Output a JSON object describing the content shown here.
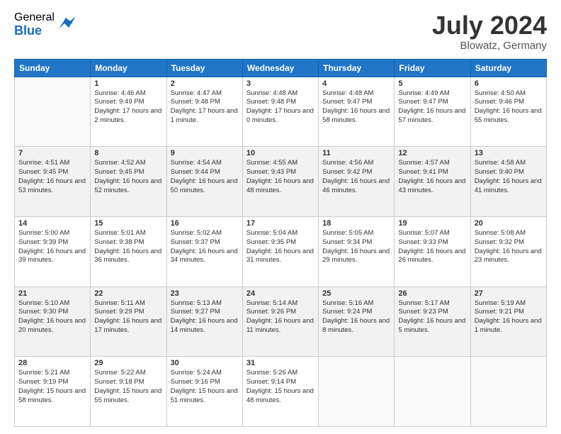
{
  "header": {
    "logo_general": "General",
    "logo_blue": "Blue",
    "month_year": "July 2024",
    "location": "Blowatz, Germany"
  },
  "days_of_week": [
    "Sunday",
    "Monday",
    "Tuesday",
    "Wednesday",
    "Thursday",
    "Friday",
    "Saturday"
  ],
  "weeks": [
    [
      {
        "day": "",
        "sunrise": "",
        "sunset": "",
        "daylight": ""
      },
      {
        "day": "1",
        "sunrise": "Sunrise: 4:46 AM",
        "sunset": "Sunset: 9:49 PM",
        "daylight": "Daylight: 17 hours and 2 minutes."
      },
      {
        "day": "2",
        "sunrise": "Sunrise: 4:47 AM",
        "sunset": "Sunset: 9:48 PM",
        "daylight": "Daylight: 17 hours and 1 minute."
      },
      {
        "day": "3",
        "sunrise": "Sunrise: 4:48 AM",
        "sunset": "Sunset: 9:48 PM",
        "daylight": "Daylight: 17 hours and 0 minutes."
      },
      {
        "day": "4",
        "sunrise": "Sunrise: 4:48 AM",
        "sunset": "Sunset: 9:47 PM",
        "daylight": "Daylight: 16 hours and 58 minutes."
      },
      {
        "day": "5",
        "sunrise": "Sunrise: 4:49 AM",
        "sunset": "Sunset: 9:47 PM",
        "daylight": "Daylight: 16 hours and 57 minutes."
      },
      {
        "day": "6",
        "sunrise": "Sunrise: 4:50 AM",
        "sunset": "Sunset: 9:46 PM",
        "daylight": "Daylight: 16 hours and 55 minutes."
      }
    ],
    [
      {
        "day": "7",
        "sunrise": "Sunrise: 4:51 AM",
        "sunset": "Sunset: 9:45 PM",
        "daylight": "Daylight: 16 hours and 53 minutes."
      },
      {
        "day": "8",
        "sunrise": "Sunrise: 4:52 AM",
        "sunset": "Sunset: 9:45 PM",
        "daylight": "Daylight: 16 hours and 52 minutes."
      },
      {
        "day": "9",
        "sunrise": "Sunrise: 4:54 AM",
        "sunset": "Sunset: 9:44 PM",
        "daylight": "Daylight: 16 hours and 50 minutes."
      },
      {
        "day": "10",
        "sunrise": "Sunrise: 4:55 AM",
        "sunset": "Sunset: 9:43 PM",
        "daylight": "Daylight: 16 hours and 48 minutes."
      },
      {
        "day": "11",
        "sunrise": "Sunrise: 4:56 AM",
        "sunset": "Sunset: 9:42 PM",
        "daylight": "Daylight: 16 hours and 46 minutes."
      },
      {
        "day": "12",
        "sunrise": "Sunrise: 4:57 AM",
        "sunset": "Sunset: 9:41 PM",
        "daylight": "Daylight: 16 hours and 43 minutes."
      },
      {
        "day": "13",
        "sunrise": "Sunrise: 4:58 AM",
        "sunset": "Sunset: 9:40 PM",
        "daylight": "Daylight: 16 hours and 41 minutes."
      }
    ],
    [
      {
        "day": "14",
        "sunrise": "Sunrise: 5:00 AM",
        "sunset": "Sunset: 9:39 PM",
        "daylight": "Daylight: 16 hours and 39 minutes."
      },
      {
        "day": "15",
        "sunrise": "Sunrise: 5:01 AM",
        "sunset": "Sunset: 9:38 PM",
        "daylight": "Daylight: 16 hours and 36 minutes."
      },
      {
        "day": "16",
        "sunrise": "Sunrise: 5:02 AM",
        "sunset": "Sunset: 9:37 PM",
        "daylight": "Daylight: 16 hours and 34 minutes."
      },
      {
        "day": "17",
        "sunrise": "Sunrise: 5:04 AM",
        "sunset": "Sunset: 9:35 PM",
        "daylight": "Daylight: 16 hours and 31 minutes."
      },
      {
        "day": "18",
        "sunrise": "Sunrise: 5:05 AM",
        "sunset": "Sunset: 9:34 PM",
        "daylight": "Daylight: 16 hours and 29 minutes."
      },
      {
        "day": "19",
        "sunrise": "Sunrise: 5:07 AM",
        "sunset": "Sunset: 9:33 PM",
        "daylight": "Daylight: 16 hours and 26 minutes."
      },
      {
        "day": "20",
        "sunrise": "Sunrise: 5:08 AM",
        "sunset": "Sunset: 9:32 PM",
        "daylight": "Daylight: 16 hours and 23 minutes."
      }
    ],
    [
      {
        "day": "21",
        "sunrise": "Sunrise: 5:10 AM",
        "sunset": "Sunset: 9:30 PM",
        "daylight": "Daylight: 16 hours and 20 minutes."
      },
      {
        "day": "22",
        "sunrise": "Sunrise: 5:11 AM",
        "sunset": "Sunset: 9:29 PM",
        "daylight": "Daylight: 16 hours and 17 minutes."
      },
      {
        "day": "23",
        "sunrise": "Sunrise: 5:13 AM",
        "sunset": "Sunset: 9:27 PM",
        "daylight": "Daylight: 16 hours and 14 minutes."
      },
      {
        "day": "24",
        "sunrise": "Sunrise: 5:14 AM",
        "sunset": "Sunset: 9:26 PM",
        "daylight": "Daylight: 16 hours and 11 minutes."
      },
      {
        "day": "25",
        "sunrise": "Sunrise: 5:16 AM",
        "sunset": "Sunset: 9:24 PM",
        "daylight": "Daylight: 16 hours and 8 minutes."
      },
      {
        "day": "26",
        "sunrise": "Sunrise: 5:17 AM",
        "sunset": "Sunset: 9:23 PM",
        "daylight": "Daylight: 16 hours and 5 minutes."
      },
      {
        "day": "27",
        "sunrise": "Sunrise: 5:19 AM",
        "sunset": "Sunset: 9:21 PM",
        "daylight": "Daylight: 16 hours and 1 minute."
      }
    ],
    [
      {
        "day": "28",
        "sunrise": "Sunrise: 5:21 AM",
        "sunset": "Sunset: 9:19 PM",
        "daylight": "Daylight: 15 hours and 58 minutes."
      },
      {
        "day": "29",
        "sunrise": "Sunrise: 5:22 AM",
        "sunset": "Sunset: 9:18 PM",
        "daylight": "Daylight: 15 hours and 55 minutes."
      },
      {
        "day": "30",
        "sunrise": "Sunrise: 5:24 AM",
        "sunset": "Sunset: 9:16 PM",
        "daylight": "Daylight: 15 hours and 51 minutes."
      },
      {
        "day": "31",
        "sunrise": "Sunrise: 5:26 AM",
        "sunset": "Sunset: 9:14 PM",
        "daylight": "Daylight: 15 hours and 48 minutes."
      },
      {
        "day": "",
        "sunrise": "",
        "sunset": "",
        "daylight": ""
      },
      {
        "day": "",
        "sunrise": "",
        "sunset": "",
        "daylight": ""
      },
      {
        "day": "",
        "sunrise": "",
        "sunset": "",
        "daylight": ""
      }
    ]
  ]
}
